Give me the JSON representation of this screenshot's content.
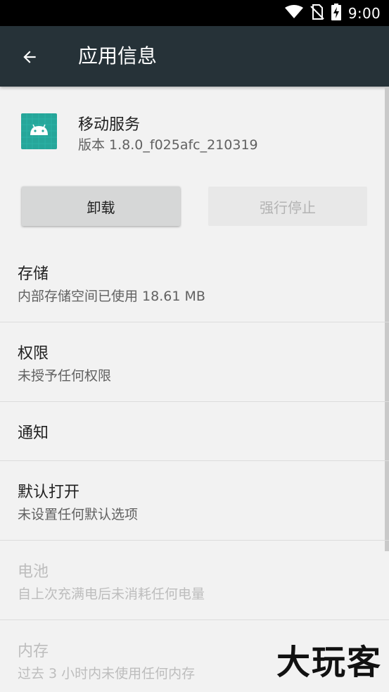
{
  "status_bar": {
    "time": "9:00",
    "icons": [
      "wifi-icon",
      "no-sim-icon",
      "battery-charging-icon"
    ]
  },
  "app_bar": {
    "title": "应用信息",
    "back_icon": "arrow-back-icon"
  },
  "app": {
    "name": "移动服务",
    "version": "版本 1.8.0_f025afc_210319",
    "icon": "android-icon",
    "icon_color": "#26a69a"
  },
  "buttons": {
    "uninstall": "卸载",
    "force_stop": "强行停止"
  },
  "settings": [
    {
      "title": "存储",
      "summary": "内部存储空间已使用 18.61 MB",
      "enabled": true
    },
    {
      "title": "权限",
      "summary": "未授予任何权限",
      "enabled": true
    },
    {
      "title": "通知",
      "summary": "",
      "enabled": true
    },
    {
      "title": "默认打开",
      "summary": "未设置任何默认选项",
      "enabled": true
    },
    {
      "title": "电池",
      "summary": "自上次充满电后未消耗任何电量",
      "enabled": false
    },
    {
      "title": "内存",
      "summary": "过去 3 小时内未使用任何内存",
      "enabled": false
    }
  ],
  "watermark": "大玩客",
  "colors": {
    "app_bar": "#263238",
    "status_bar": "#000000",
    "background": "#f2f2f2"
  }
}
